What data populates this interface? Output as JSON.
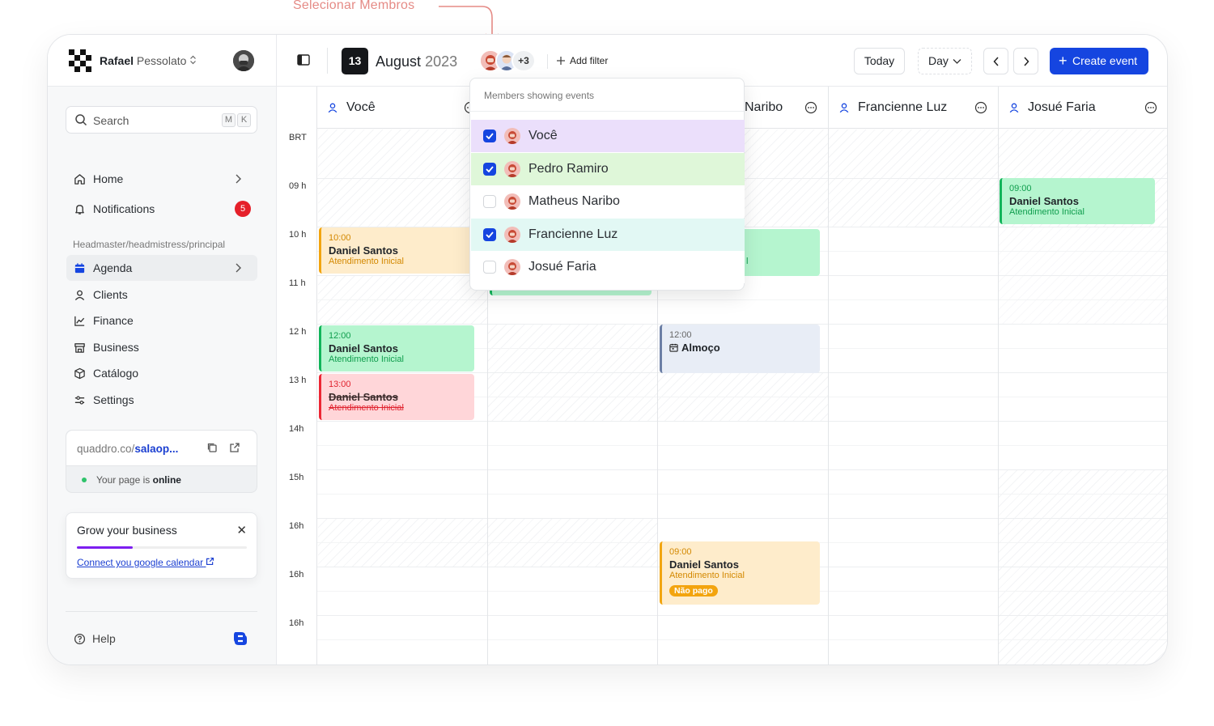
{
  "callout": {
    "text": "Selecionar Membros"
  },
  "user": {
    "first": "Rafael",
    "last": "Pessolato"
  },
  "search": {
    "placeholder": "Search",
    "key1": "M",
    "key2": "K"
  },
  "nav": {
    "home": "Home",
    "notifications": "Notifications",
    "notifications_count": "5",
    "section": "Headmaster/headmistress/principal",
    "agenda": "Agenda",
    "clients": "Clients",
    "finance": "Finance",
    "business": "Business",
    "catalog": "Catálogo",
    "settings": "Settings"
  },
  "page_card": {
    "url_prefix": "quaddro.co/",
    "url_slug": "salaop...",
    "status_prefix": "Your page",
    "status_is": "is",
    "status_word": "online"
  },
  "grow": {
    "title": "Grow your business",
    "progress": 0.33,
    "link": "Connect you google calendar"
  },
  "help": {
    "label": "Help"
  },
  "topbar": {
    "day": "13",
    "month": "August",
    "year": "2023",
    "more_members": "+3",
    "add_filter": "Add filter",
    "today": "Today",
    "view": "Day",
    "create": "Create event"
  },
  "timezone": "BRT",
  "hours": [
    "09 h",
    "10 h",
    "11 h",
    "12 h",
    "13 h",
    "14h",
    "15h",
    "16h",
    "16h",
    "16h"
  ],
  "columns": [
    "Você",
    "Pedro Ramiro",
    "Matheus Naribo",
    "Francienne Luz",
    "Josué Faria"
  ],
  "column_fragment": "Naribo",
  "dropdown": {
    "title": "Members showing events",
    "members": [
      {
        "name": "Você",
        "checked": true,
        "bg": "#ebdffb"
      },
      {
        "name": "Pedro Ramiro",
        "checked": true,
        "bg": "#dff7d9"
      },
      {
        "name": "Matheus Naribo",
        "checked": false,
        "bg": "#ffffff"
      },
      {
        "name": "Francienne Luz",
        "checked": true,
        "bg": "#e2f8f4"
      },
      {
        "name": "Josué Faria",
        "checked": false,
        "bg": "#ffffff"
      }
    ]
  },
  "events": {
    "e1": {
      "time": "10:00",
      "name": "Daniel Santos",
      "sub": "Atendimento Inicial"
    },
    "e2": {
      "time": "12:00",
      "name": "Daniel Santos",
      "sub": "Atendimento Inicial"
    },
    "e3": {
      "time": "13:00",
      "name": "Daniel Santos",
      "sub": "Atendimento Inicial"
    },
    "e4": {
      "time": "12:00",
      "name": "Almoço"
    },
    "e5": {
      "time": "09:00",
      "name": "Daniel Santos",
      "sub": "Atendimento Inicial",
      "tag": "Não pago"
    },
    "e6": {
      "time": "09:00",
      "name": "Daniel Santos",
      "sub": "Atendimento Inicial"
    },
    "e7": {
      "sub_fragment": "l"
    }
  },
  "colors": {
    "accent": "#1545e0",
    "badge": "#e5202a",
    "progress": "#7d1ef0"
  }
}
